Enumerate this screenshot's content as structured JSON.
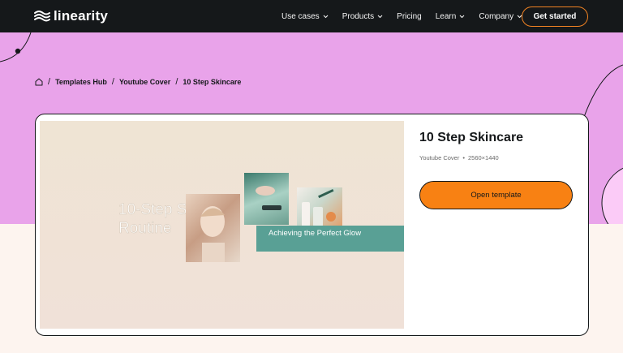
{
  "nav": {
    "logo_text": "linearity",
    "links": [
      {
        "label": "Use cases",
        "has_dropdown": true
      },
      {
        "label": "Products",
        "has_dropdown": true
      },
      {
        "label": "Pricing",
        "has_dropdown": false
      },
      {
        "label": "Learn",
        "has_dropdown": true
      },
      {
        "label": "Company",
        "has_dropdown": true
      }
    ],
    "cta_label": "Get started"
  },
  "breadcrumb": {
    "home_icon": "home-icon",
    "items": [
      "Templates Hub",
      "Youtube Cover",
      "10 Step Skincare"
    ],
    "separator": "/"
  },
  "template": {
    "title": "10 Step Skincare",
    "category": "Youtube Cover",
    "meta_separator": "•",
    "dimensions": "2560×1440",
    "open_label": "Open template",
    "preview": {
      "headline": "10-Step Skincare Routine",
      "banner": "Achieving the Perfect Glow"
    }
  },
  "colors": {
    "nav_bg": "#15181a",
    "hero_bg": "#e9a3ea",
    "accent_orange": "#f88113",
    "banner_teal": "#59a095",
    "page_bg": "#fdf4ef"
  }
}
